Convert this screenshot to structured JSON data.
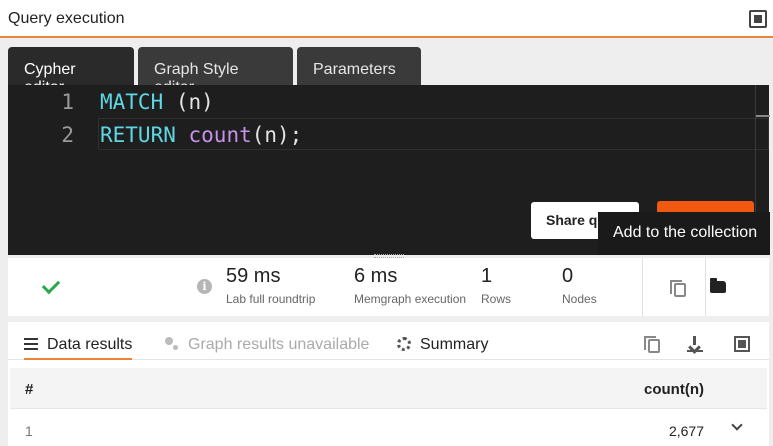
{
  "header": {
    "title": "Query execution",
    "fullscreen_icon": "fullscreen-icon"
  },
  "editor": {
    "tabs": [
      {
        "label": "Cypher editor",
        "active": true
      },
      {
        "label": "Graph Style editor",
        "active": false
      },
      {
        "label": "Parameters",
        "active": false
      }
    ],
    "lines": [
      {
        "number": "1",
        "keyword": "MATCH",
        "rest": " (n)"
      },
      {
        "number": "2",
        "keyword": "RETURN",
        "fn": "count",
        "rest": "(n);"
      }
    ],
    "share_label": "Share query",
    "tooltip": "Add to the collection",
    "colors": {
      "keyword": "#5fd6e3",
      "function": "#c792ea",
      "run_button": "#f0590f"
    }
  },
  "stats": {
    "status_icon": "check-icon",
    "items": [
      {
        "value": "59 ms",
        "label": "Lab full roundtrip"
      },
      {
        "value": "6 ms",
        "label": "Memgraph execution"
      },
      {
        "value": "1",
        "label": "Rows"
      },
      {
        "value": "0",
        "label": "Nodes"
      }
    ]
  },
  "results": {
    "tabs": [
      {
        "label": "Data results",
        "icon": "list-icon",
        "active": true
      },
      {
        "label": "Graph results unavailable",
        "icon": "graph-icon",
        "disabled": true
      },
      {
        "label": "Summary",
        "icon": "gear-icon"
      }
    ],
    "columns": [
      "#",
      "count(n)"
    ],
    "rows": [
      {
        "index": "1",
        "value": "2,677"
      }
    ],
    "accent": "#e8853b"
  }
}
